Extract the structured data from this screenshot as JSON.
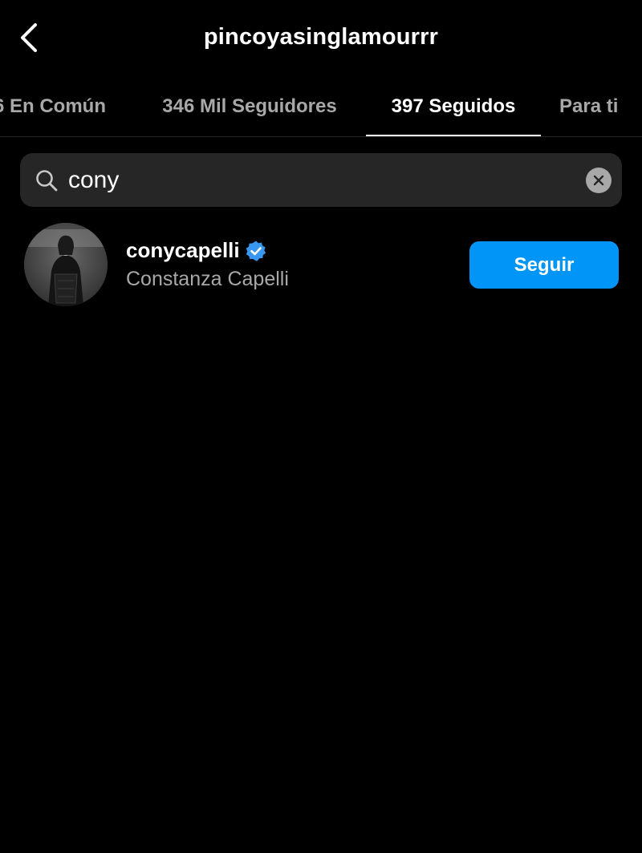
{
  "header": {
    "title": "pincoyasinglamourrr"
  },
  "tabs": [
    {
      "label": "6 En Común",
      "active": false
    },
    {
      "label": "346 Mil Seguidores",
      "active": false
    },
    {
      "label": "397 Seguidos",
      "active": true
    },
    {
      "label": "Para ti",
      "active": false
    }
  ],
  "search": {
    "value": "cony",
    "icon": "search-icon",
    "clear_icon": "close-icon"
  },
  "results": [
    {
      "username": "conycapelli",
      "full_name": "Constanza Capelli",
      "verified": true,
      "button_label": "Seguir"
    }
  ],
  "colors": {
    "background": "#000000",
    "primary_button": "#0095f6",
    "secondary_text": "#a8a8a8",
    "search_bg": "#262626",
    "verified": "#3897f0"
  }
}
